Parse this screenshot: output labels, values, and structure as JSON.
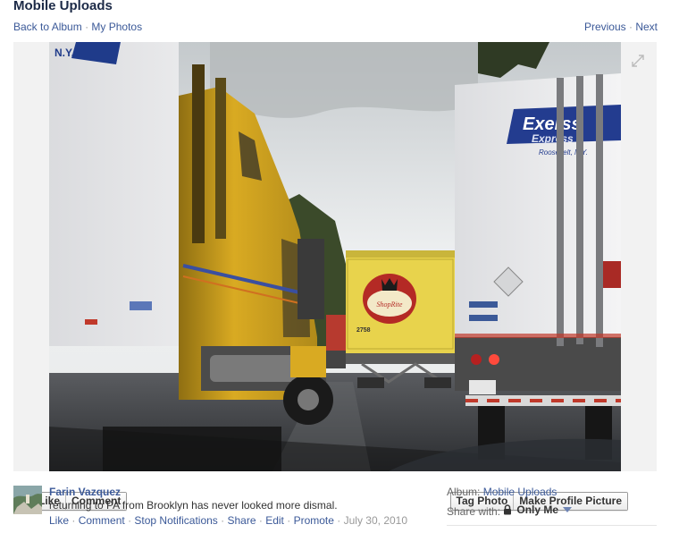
{
  "header": {
    "title": "Mobile Uploads"
  },
  "nav": {
    "back": "Back to Album",
    "my_photos": "My Photos",
    "previous": "Previous",
    "next": "Next",
    "dot": "·"
  },
  "photo_actions": {
    "like": "Like",
    "comment": "Comment",
    "tag": "Tag Photo",
    "profile": "Make Profile Picture"
  },
  "photo_text": {
    "truck_sign_1": "Exerss",
    "truck_sign_2": "Express",
    "truck_sign_3": "Roosevelt, N.Y.",
    "ny_sign": "N.Y.",
    "yellow_truck_number": "2758",
    "logo_text": "ShopRite"
  },
  "post": {
    "author": "Farin Vazquez",
    "caption": "returning to PA from Brooklyn has never looked more dismal.",
    "actions": [
      "Like",
      "Comment",
      "Stop Notifications",
      "Share",
      "Edit",
      "Promote"
    ],
    "timestamp": "July 30, 2010"
  },
  "album_info": {
    "album_label": "Album:",
    "album_name": "Mobile Uploads",
    "share_label": "Share with:",
    "share_value": "Only Me"
  },
  "colors": {
    "link": "#3b5998",
    "title": "#1c2a47",
    "muted": "#999999",
    "stage": "#f2f2f2"
  },
  "icons": [
    "expand-icon",
    "lock-icon",
    "dropdown-arrow-icon"
  ]
}
